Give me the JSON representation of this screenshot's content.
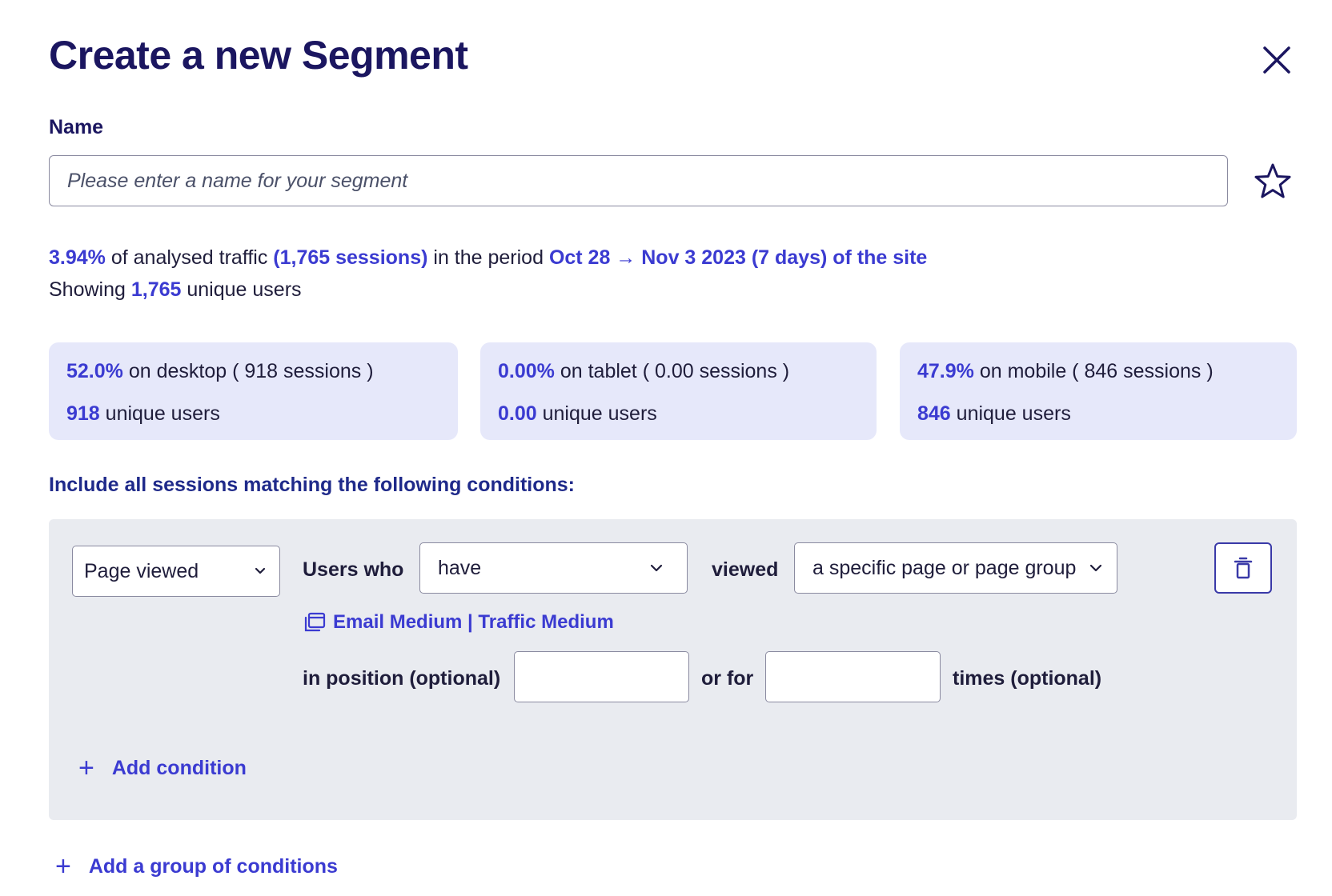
{
  "dialog": {
    "title": "Create a new Segment",
    "close_icon": "close-icon",
    "favorite_icon": "star-icon"
  },
  "name_field": {
    "label": "Name",
    "placeholder": "Please enter a name for your segment",
    "value": ""
  },
  "stats": {
    "traffic_percent": "3.94%",
    "traffic_text": " of analysed traffic ",
    "sessions": "(1,765 sessions)",
    "period_text": " in the period ",
    "period": "Oct 28 → Nov 3 2023 (7 days) of the site",
    "showing_text": "Showing ",
    "unique_users": "1,765",
    "unique_users_text": " unique users"
  },
  "devices": [
    {
      "percent": "52.0%",
      "desc": " on desktop ( 918 sessions )",
      "users": "918",
      "users_text": " unique users"
    },
    {
      "percent": "0.00%",
      "desc": " on tablet ( 0.00 sessions )",
      "users": "0.00",
      "users_text": " unique users"
    },
    {
      "percent": "47.9%",
      "desc": " on mobile ( 846 sessions )",
      "users": "846",
      "users_text": " unique users"
    }
  ],
  "conditions": {
    "heading": "Include all sessions matching the following conditions:",
    "type_select": "Page viewed",
    "users_who_label": "Users who",
    "have_select": "have",
    "viewed_label": "viewed",
    "page_select": "a specific page or page group",
    "pages_link": "Email Medium | Traffic Medium",
    "pages_icon": "copy-window-icon",
    "position_label": "in position (optional)",
    "position_value": "",
    "or_for_label": "or for",
    "times_value": "",
    "times_label": "times (optional)",
    "delete_icon": "trash-icon",
    "add_condition": "Add condition",
    "add_group": "Add a group of conditions"
  },
  "colors": {
    "title": "#1b1660",
    "accent": "#3b3bd1",
    "card_bg": "#e6e8fa",
    "panel_bg": "#e9ebf0"
  }
}
